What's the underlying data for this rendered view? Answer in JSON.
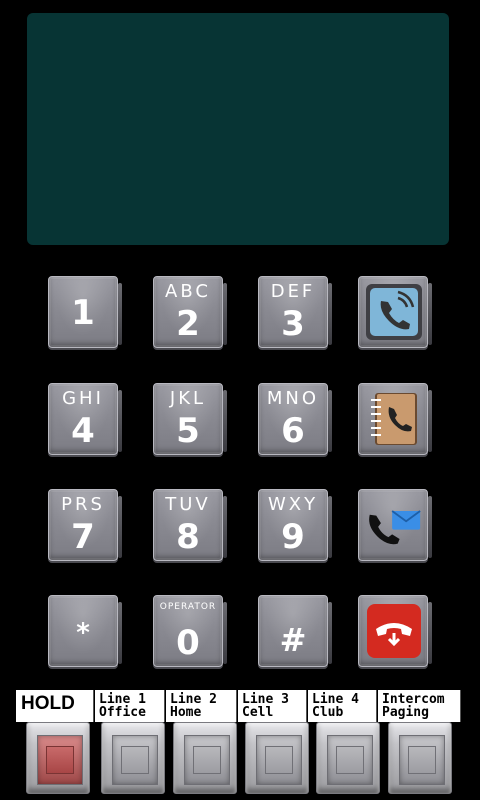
{
  "keypad": {
    "keys": [
      {
        "digit": "1",
        "letters": ""
      },
      {
        "digit": "2",
        "letters": "ABC"
      },
      {
        "digit": "3",
        "letters": "DEF"
      },
      {
        "digit": "4",
        "letters": "GHI"
      },
      {
        "digit": "5",
        "letters": "JKL"
      },
      {
        "digit": "6",
        "letters": "MNO"
      },
      {
        "digit": "7",
        "letters": "PRS"
      },
      {
        "digit": "8",
        "letters": "TUV"
      },
      {
        "digit": "9",
        "letters": "WXY"
      },
      {
        "digit": "*",
        "letters": ""
      },
      {
        "digit": "0",
        "letters": "OPERATOR"
      },
      {
        "digit": "#",
        "letters": ""
      }
    ],
    "function_keys": [
      {
        "icon": "call-icon",
        "color": "#7fb6d8"
      },
      {
        "icon": "phonebook-icon",
        "color": "#c99a6e"
      },
      {
        "icon": "voicemail-icon",
        "color": "#3a8ee6"
      },
      {
        "icon": "hangup-icon",
        "color": "#d42a20"
      }
    ]
  },
  "lines": {
    "hold": "HOLD",
    "buttons": [
      {
        "line": "Line 1",
        "sub": "Office"
      },
      {
        "line": "Line 2",
        "sub": "Home"
      },
      {
        "line": "Line 3",
        "sub": "Cell"
      },
      {
        "line": "Line 4",
        "sub": "Club"
      },
      {
        "line": "Intercom",
        "sub": "Paging"
      }
    ]
  }
}
